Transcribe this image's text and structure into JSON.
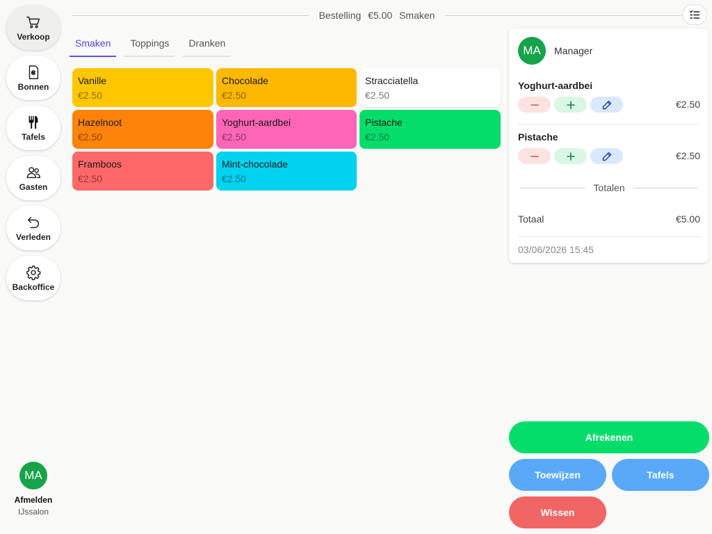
{
  "sidebar": {
    "items": [
      {
        "label": "Verkoop",
        "icon": "cart-icon"
      },
      {
        "label": "Bonnen",
        "icon": "receipt-euro-icon"
      },
      {
        "label": "Tafels",
        "icon": "utensils-icon"
      },
      {
        "label": "Gasten",
        "icon": "users-icon"
      },
      {
        "label": "Verleden",
        "icon": "undo-icon"
      },
      {
        "label": "Backoffice",
        "icon": "gear-icon"
      }
    ],
    "user_initials": "MA",
    "logout_label": "Afmelden",
    "shop_name": "IJssalon"
  },
  "orderbar": {
    "label": "Bestelling",
    "amount": "€5.00",
    "category": "Smaken"
  },
  "tabs": [
    {
      "label": "Smaken",
      "active": true
    },
    {
      "label": "Toppings",
      "active": false
    },
    {
      "label": "Dranken",
      "active": false
    }
  ],
  "products": [
    {
      "name": "Vanille",
      "price": "€2.50",
      "color": "#fec700"
    },
    {
      "name": "Chocolade",
      "price": "€2.50",
      "color": "#feb800"
    },
    {
      "name": "Stracciatella",
      "price": "€2.50",
      "color": "#ffffff"
    },
    {
      "name": "Hazelnoot",
      "price": "€2.50",
      "color": "#fe830b"
    },
    {
      "name": "Yoghurt-aardbei",
      "price": "€2.50",
      "color": "#fe65b6"
    },
    {
      "name": "Pistache",
      "price": "€2.50",
      "color": "#05dd6b"
    },
    {
      "name": "Framboos",
      "price": "€2.50",
      "color": "#fe6868"
    },
    {
      "name": "Mint-chocolade",
      "price": "€2.50",
      "color": "#00d2f0"
    }
  ],
  "order": {
    "user_initials": "MA",
    "user_name": "Manager",
    "lines": [
      {
        "name": "Yoghurt-aardbei",
        "price": "€2.50"
      },
      {
        "name": "Pistache",
        "price": "€2.50"
      }
    ],
    "totals_heading": "Totalen",
    "total_label": "Totaal",
    "total_value": "€5.00",
    "timestamp": "03/06/2026 15:45"
  },
  "actions": {
    "checkout": "Afrekenen",
    "assign": "Toewijzen",
    "tables": "Tafels",
    "clear": "Wissen"
  }
}
